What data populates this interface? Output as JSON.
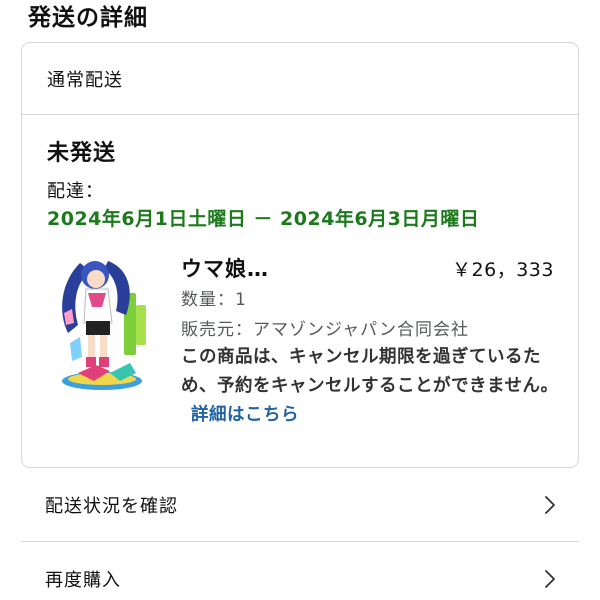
{
  "section": {
    "title": "発送の詳細"
  },
  "shipment": {
    "method": "通常配送",
    "status": "未発送",
    "delivery_label": "配達：",
    "delivery_range": "2024年6月1日土曜日 － 2024年6月3日月曜日"
  },
  "product": {
    "name": "ウマ娘…",
    "price": "￥26，333",
    "quantity": "数量：1",
    "seller": "販売元：アマゾンジャパン合同会社",
    "cancel_note": "この商品は、キャンセル期限を過ぎているため、予約をキャンセルすることができません。",
    "details_link": "詳細はこちら"
  },
  "actions": {
    "track": "配送状況を確認",
    "buy_again": "再度購入"
  },
  "colors": {
    "delivery_green": "#1c7a1c",
    "link_blue": "#2162a1",
    "border": "#d5d9d9"
  }
}
